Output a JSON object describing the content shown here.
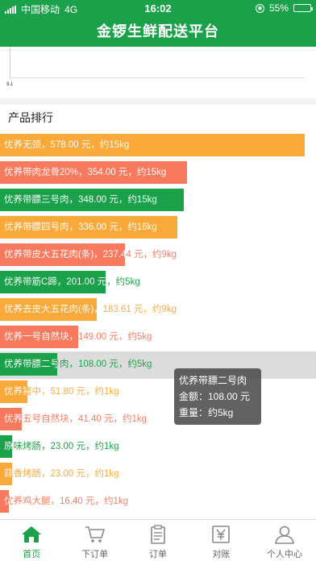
{
  "status_bar": {
    "carrier": "中国移动",
    "network": "4G",
    "time": "16:02",
    "battery": "55%",
    "battery_level": 0.55
  },
  "header": {
    "title": "金锣生鲜配送平台"
  },
  "top_chart": {
    "tick_label": "9.1"
  },
  "ranking": {
    "title": "产品排行",
    "max_amount": 578,
    "items": [
      {
        "label": "优养无颈，578.00 元，约15kg",
        "amount": 578.0,
        "color": "#f9a93a"
      },
      {
        "label": "优养带肉龙骨20%，354.00 元，约15kg",
        "amount": 354.0,
        "color": "#f77a5f"
      },
      {
        "label": "优养带膘三号肉，348.00 元，约15kg",
        "amount": 348.0,
        "color": "#1aa14a"
      },
      {
        "label": "优养带膘四号肉，336.00 元，约16kg",
        "amount": 336.0,
        "color": "#f9a93a"
      },
      {
        "label": "优养带皮大五花肉(条)，237.44 元，约9kg",
        "amount": 237.44,
        "color": "#f77a5f"
      },
      {
        "label": "优养带筋C蹄，201.00 元，约5kg",
        "amount": 201.0,
        "color": "#1aa14a"
      },
      {
        "label": "优养去皮大五花肉(条)，183.61 元，约9kg",
        "amount": 183.61,
        "color": "#f9a93a"
      },
      {
        "label": "优养一号自然块，149.00 元，约5kg",
        "amount": 149.0,
        "color": "#f77a5f"
      },
      {
        "label": "优养带膘二号肉，108.00 元，约5kg",
        "amount": 108.0,
        "color": "#1aa14a"
      },
      {
        "label": "优养猪中，51.80 元，约1kg",
        "amount": 51.8,
        "color": "#f9a93a"
      },
      {
        "label": "优养五号自然块，41.40 元，约1kg",
        "amount": 41.4,
        "color": "#f77a5f"
      },
      {
        "label": "原味烤肠，23.00 元，约1kg",
        "amount": 23.0,
        "color": "#1aa14a"
      },
      {
        "label": "蒜香烤肠，23.00 元，约1kg",
        "amount": 23.0,
        "color": "#f9a93a"
      },
      {
        "label": "优养鸡大腿，16.40 元，约1kg",
        "amount": 16.4,
        "color": "#f77a5f"
      }
    ],
    "highlighted_index": 8
  },
  "tooltip": {
    "name": "优养带膘二号肉",
    "amount_line": "金额：108.00 元",
    "weight_line": "重量：约5kg"
  },
  "tabbar": {
    "tabs": [
      {
        "label": "首页",
        "icon": "home-icon",
        "active": true
      },
      {
        "label": "下订单",
        "icon": "cart-icon",
        "active": false
      },
      {
        "label": "订单",
        "icon": "clipboard-icon",
        "active": false
      },
      {
        "label": "对账",
        "icon": "yen-icon",
        "active": false
      },
      {
        "label": "个人中心",
        "icon": "person-icon",
        "active": false
      }
    ]
  },
  "colors": {
    "brand_green": "#1aa14a",
    "orange": "#f9a93a",
    "salmon": "#f77a5f"
  }
}
